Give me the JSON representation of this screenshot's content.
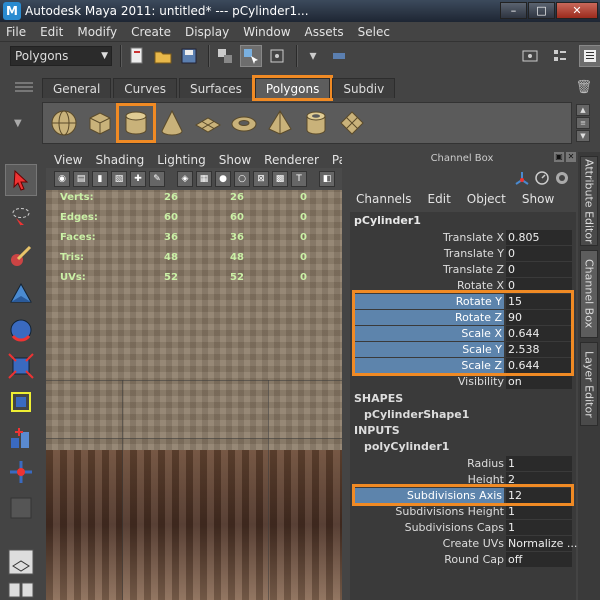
{
  "window": {
    "title": "Autodesk Maya 2011: untitled*   ---   pCylinder1...",
    "controls": [
      "–",
      "□",
      "✕"
    ]
  },
  "menubar": [
    "File",
    "Edit",
    "Modify",
    "Create",
    "Display",
    "Window",
    "Assets",
    "Selec"
  ],
  "statusline": {
    "mode": "Polygons"
  },
  "shelf": {
    "tabs": [
      "General",
      "Curves",
      "Surfaces",
      "Polygons",
      "Subdiv"
    ],
    "active_tab": "Polygons"
  },
  "viewport": {
    "menu": [
      "View",
      "Shading",
      "Lighting",
      "Show",
      "Renderer",
      "Panels"
    ],
    "hud": [
      {
        "label": "Verts:",
        "v1": "26",
        "v2": "26",
        "v3": "0"
      },
      {
        "label": "Edges:",
        "v1": "60",
        "v2": "60",
        "v3": "0"
      },
      {
        "label": "Faces:",
        "v1": "36",
        "v2": "36",
        "v3": "0"
      },
      {
        "label": "Tris:",
        "v1": "48",
        "v2": "48",
        "v3": "0"
      },
      {
        "label": "UVs:",
        "v1": "52",
        "v2": "52",
        "v3": "0"
      }
    ]
  },
  "channelbox": {
    "title": "Channel Box",
    "menu": [
      "Channels",
      "Edit",
      "Object",
      "Show"
    ],
    "object": "pCylinder1",
    "attrs": [
      {
        "label": "Translate X",
        "value": "0.805"
      },
      {
        "label": "Translate Y",
        "value": "0"
      },
      {
        "label": "Translate Z",
        "value": "0"
      },
      {
        "label": "Rotate X",
        "value": "0"
      },
      {
        "label": "Rotate Y",
        "value": "15"
      },
      {
        "label": "Rotate Z",
        "value": "90"
      },
      {
        "label": "Scale X",
        "value": "0.644"
      },
      {
        "label": "Scale Y",
        "value": "2.538"
      },
      {
        "label": "Scale Z",
        "value": "0.644"
      },
      {
        "label": "Visibility",
        "value": "on"
      }
    ],
    "shapes_header": "SHAPES",
    "shape_name": "pCylinderShape1",
    "inputs_header": "INPUTS",
    "input_name": "polyCylinder1",
    "input_attrs": [
      {
        "label": "Radius",
        "value": "1"
      },
      {
        "label": "Height",
        "value": "2"
      },
      {
        "label": "Subdivisions Axis",
        "value": "12"
      },
      {
        "label": "Subdivisions Height",
        "value": "1"
      },
      {
        "label": "Subdivisions Caps",
        "value": "1"
      },
      {
        "label": "Create UVs",
        "value": "Normalize ..."
      },
      {
        "label": "Round Cap",
        "value": "off"
      }
    ]
  },
  "sidetabs": [
    "Attribute Editor",
    "Channel Box",
    "Layer Editor"
  ],
  "colors": {
    "highlight": "#f08a24",
    "selected_row": "#5d84ac",
    "hud_text": "#caf0a6"
  }
}
